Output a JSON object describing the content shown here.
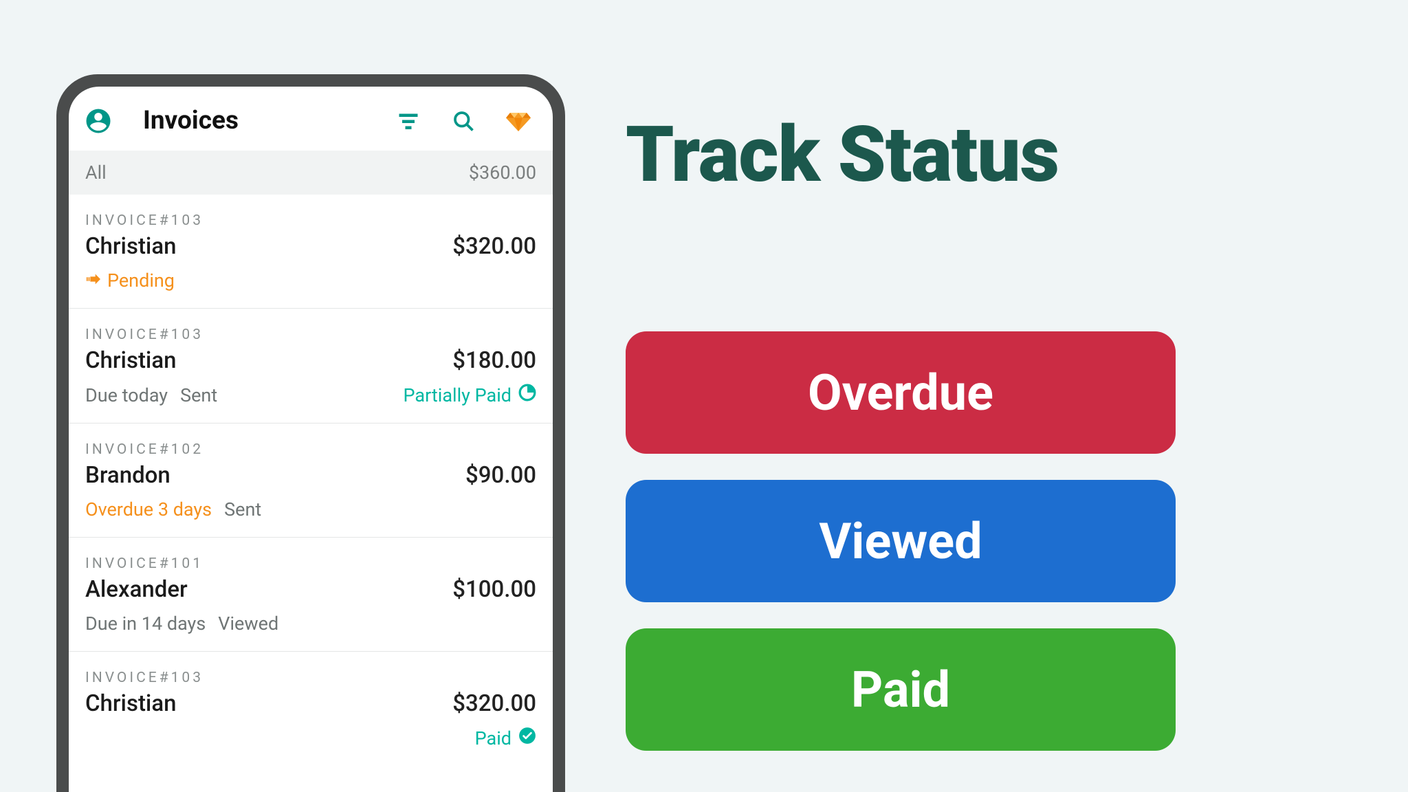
{
  "colors": {
    "teal": "#009688",
    "tealLight": "#00b7a2",
    "orange": "#f5901c",
    "headingGreen": "#1c584d",
    "overdue": "#cb2c44",
    "viewed": "#1d6ed0",
    "paid": "#3cab33"
  },
  "appbar": {
    "title": "Invoices"
  },
  "summary": {
    "label": "All",
    "total": "$360.00"
  },
  "invoices": [
    {
      "number": "INVOICE#103",
      "client": "Christian",
      "amount": "$320.00",
      "pending_label": "Pending"
    },
    {
      "number": "INVOICE#103",
      "client": "Christian",
      "amount": "$180.00",
      "due": "Due today",
      "sent": "Sent",
      "partial": "Partially Paid"
    },
    {
      "number": "INVOICE#102",
      "client": "Brandon",
      "amount": "$90.00",
      "overdue": "Overdue 3 days",
      "sent": "Sent"
    },
    {
      "number": "INVOICE#101",
      "client": "Alexander",
      "amount": "$100.00",
      "due": "Due in 14 days",
      "viewed": "Viewed"
    },
    {
      "number": "INVOICE#103",
      "client": "Christian",
      "amount": "$320.00",
      "paid": "Paid"
    }
  ],
  "right": {
    "heading": "Track Status",
    "pills": [
      "Overdue",
      "Viewed",
      "Paid"
    ]
  }
}
